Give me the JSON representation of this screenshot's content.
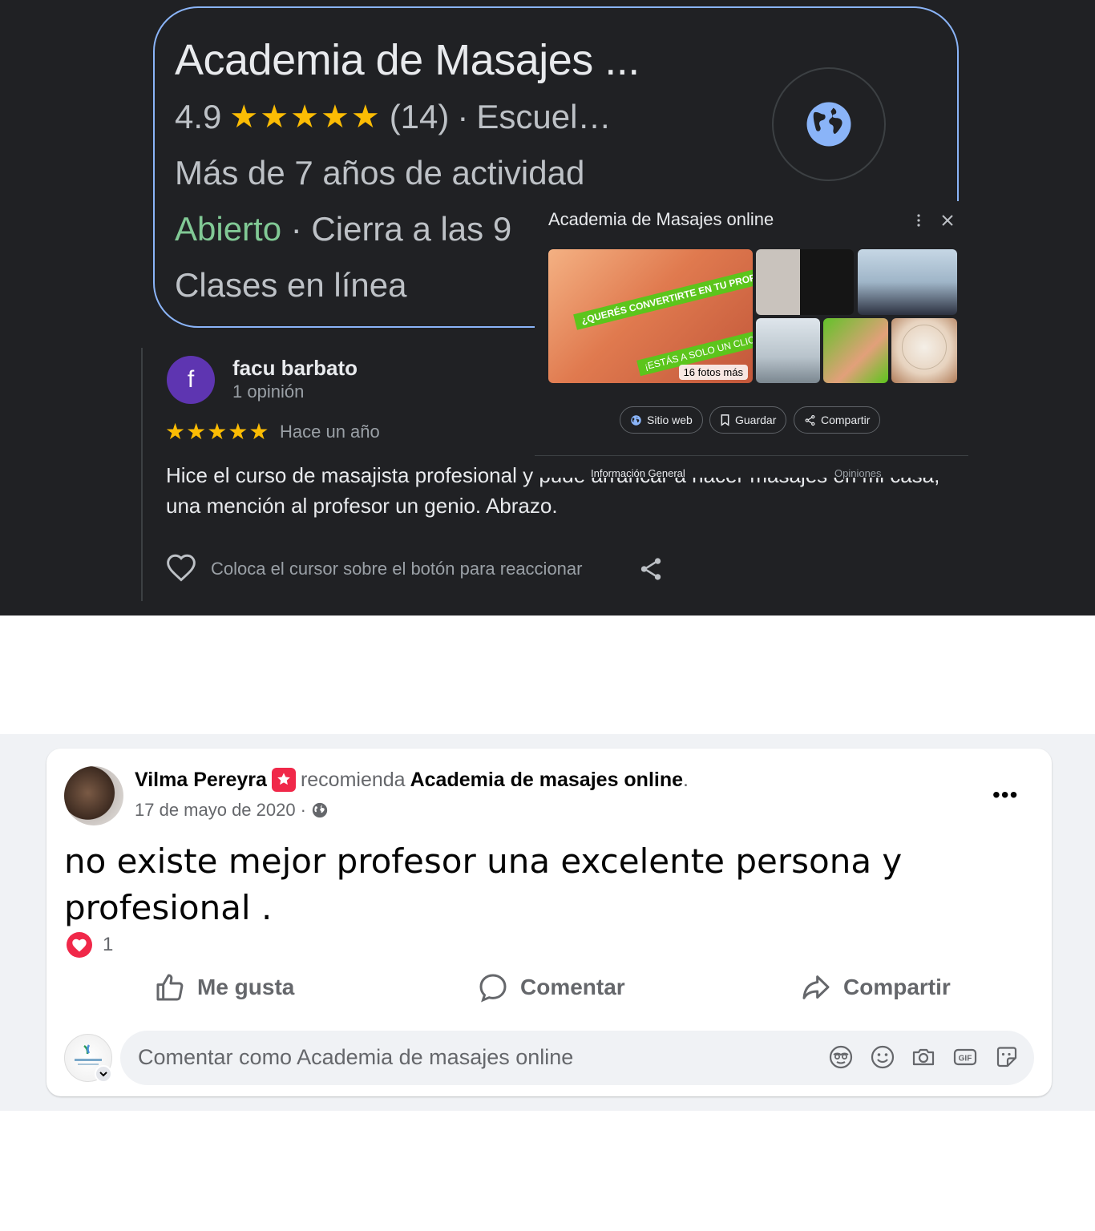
{
  "google_maps": {
    "business": {
      "title": "Academia de Masajes ...",
      "rating": "4.9",
      "stars": "★★★★★",
      "reviews_count": "(14)",
      "separator": "·",
      "category": "Escuel…",
      "years": "Más de 7 años de actividad",
      "status_open": "Abierto",
      "hours": "Cierra a las 9",
      "service": "Clases en línea",
      "website_icon": "globe-icon"
    },
    "review": {
      "avatar_letter": "f",
      "author": "facu barbato",
      "author_count": "1 opinión",
      "stars": "★★★★★",
      "time": "Hace un año",
      "text": "Hice el curso de masajista profesional y pude arrancar a hacer masajes en mi casa, una mención al profesor un genio. Abrazo.",
      "react_hint": "Coloca el cursor sobre el botón para reaccionar"
    },
    "knowledge_panel": {
      "title": "Academia de Masajes online",
      "photo_banner_1": "¿QUERÉS CONVERTIRTE EN TU PROFESIONAL DEL MASAJE?",
      "photo_banner_2": "¡ESTÁS A SOLO UN CLIC",
      "more_photos": "16 fotos más",
      "buttons": {
        "website": "Sitio web",
        "save": "Guardar",
        "share": "Compartir"
      },
      "tabs": {
        "general": "Información General",
        "reviews": "Opiniones"
      }
    }
  },
  "facebook_post": {
    "author": "Vilma Pereyra",
    "verb": "recomienda",
    "page": "Academia de masajes online",
    "period": ".",
    "date": "17 de mayo de 2020",
    "dot": "·",
    "privacy_icon": "globe-icon",
    "more": "•••",
    "text": "no existe mejor profesor una excelente persona y profesional .",
    "reaction_count": "1",
    "actions": {
      "like": "Me gusta",
      "comment": "Comentar",
      "share": "Compartir"
    },
    "comment_placeholder": "Comentar como Academia de masajes online"
  },
  "colors": {
    "maps_bg": "#202124",
    "accent_blue": "#8ab4f8",
    "star_yellow": "#fbbc04",
    "open_green": "#81c995",
    "fb_bg": "#f0f2f5",
    "fb_love": "#f02849"
  }
}
